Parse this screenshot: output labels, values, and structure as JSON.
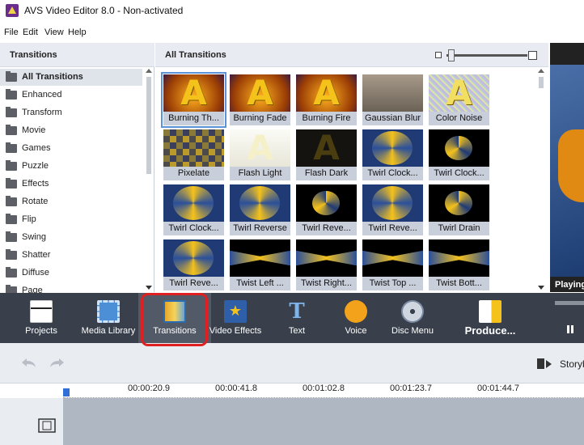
{
  "window": {
    "title": "AVS Video Editor 8.0 - Non-activated"
  },
  "menu": [
    "File",
    "Edit",
    "View",
    "Help"
  ],
  "left_panel": {
    "title": "Transitions",
    "categories": [
      "All Transitions",
      "Enhanced",
      "Transform",
      "Movie",
      "Games",
      "Puzzle",
      "Effects",
      "Rotate",
      "Flip",
      "Swing",
      "Shatter",
      "Diffuse",
      "Page"
    ],
    "selected": "All Transitions"
  },
  "main_panel": {
    "title": "All Transitions",
    "transitions": [
      {
        "label": "Burning Th...",
        "style": "fire"
      },
      {
        "label": "Burning Fade",
        "style": "fire"
      },
      {
        "label": "Burning Fire",
        "style": "fire"
      },
      {
        "label": "Gaussian Blur",
        "style": "blur"
      },
      {
        "label": "Color Noise",
        "style": "noise"
      },
      {
        "label": "Pixelate",
        "style": "pixel"
      },
      {
        "label": "Flash Light",
        "style": "light"
      },
      {
        "label": "Flash Dark",
        "style": "dark"
      },
      {
        "label": "Twirl Clock...",
        "style": "twirl"
      },
      {
        "label": "Twirl Clock...",
        "style": "twirl-dark"
      },
      {
        "label": "Twirl Clock...",
        "style": "twirl"
      },
      {
        "label": "Twirl Reverse",
        "style": "twirl"
      },
      {
        "label": "Twirl Reve...",
        "style": "twirl-dark"
      },
      {
        "label": "Twirl Reve...",
        "style": "twirl"
      },
      {
        "label": "Twirl Drain",
        "style": "twirl-dark"
      },
      {
        "label": "Twirl Reve...",
        "style": "twirl"
      },
      {
        "label": "Twist Left ...",
        "style": "twist"
      },
      {
        "label": "Twist Right...",
        "style": "twist"
      },
      {
        "label": "Twist Top ...",
        "style": "twist"
      },
      {
        "label": "Twist Bott...",
        "style": "twist"
      }
    ]
  },
  "preview": {
    "status": "Playing"
  },
  "toolbar": {
    "items": [
      {
        "label": "Projects",
        "icon": "clapper-icon"
      },
      {
        "label": "Media Library",
        "icon": "film-icon"
      },
      {
        "label": "Transitions",
        "icon": "transitions-icon"
      },
      {
        "label": "Video Effects",
        "icon": "star-icon"
      },
      {
        "label": "Text",
        "icon": "text-icon"
      },
      {
        "label": "Voice",
        "icon": "microphone-icon"
      },
      {
        "label": "Disc Menu",
        "icon": "disc-icon"
      },
      {
        "label": "Produce...",
        "icon": "produce-icon"
      }
    ],
    "active": "Transitions"
  },
  "timeline": {
    "view_label": "Storyb",
    "timecodes": [
      "00:00:20.9",
      "00:00:41.8",
      "00:01:02.8",
      "00:01:23.7",
      "00:01:44.7"
    ]
  },
  "colors": {
    "toolbar_bg": "#39404c",
    "highlight": "#e02020",
    "accent": "#f5c21b",
    "label_bg": "#c9cedb"
  }
}
